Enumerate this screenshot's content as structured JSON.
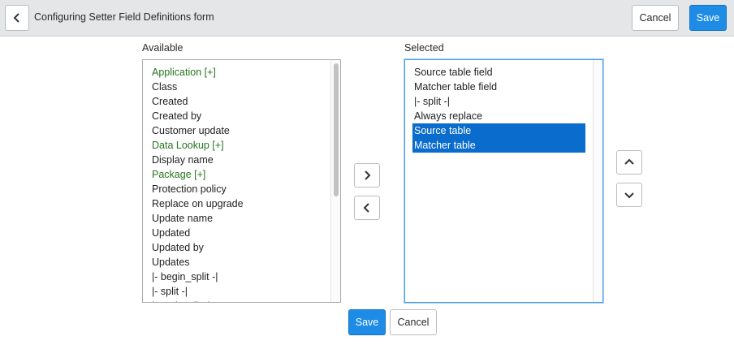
{
  "header": {
    "title": "Configuring Setter Field Definitions form",
    "cancel_label": "Cancel",
    "save_label": "Save",
    "back_icon": "chevron-left-icon"
  },
  "available": {
    "label": "Available",
    "items": [
      {
        "label": "Application [+]",
        "expandable": true
      },
      {
        "label": "Class",
        "expandable": false
      },
      {
        "label": "Created",
        "expandable": false
      },
      {
        "label": "Created by",
        "expandable": false
      },
      {
        "label": "Customer update",
        "expandable": false
      },
      {
        "label": "Data Lookup [+]",
        "expandable": true
      },
      {
        "label": "Display name",
        "expandable": false
      },
      {
        "label": "Package [+]",
        "expandable": true
      },
      {
        "label": "Protection policy",
        "expandable": false
      },
      {
        "label": "Replace on upgrade",
        "expandable": false
      },
      {
        "label": "Update name",
        "expandable": false
      },
      {
        "label": "Updated",
        "expandable": false
      },
      {
        "label": "Updated by",
        "expandable": false
      },
      {
        "label": "Updates",
        "expandable": false
      },
      {
        "label": "|- begin_split -|",
        "expandable": false
      },
      {
        "label": "|- split -|",
        "expandable": false
      },
      {
        "label": "|- end_split -|",
        "expandable": false
      }
    ]
  },
  "selected": {
    "label": "Selected",
    "items": [
      {
        "label": "Source table field",
        "highlighted": false
      },
      {
        "label": "Matcher table field",
        "highlighted": false
      },
      {
        "label": "|- split -|",
        "highlighted": false
      },
      {
        "label": "Always replace",
        "highlighted": false
      },
      {
        "label": "Source table",
        "highlighted": true
      },
      {
        "label": "Matcher table",
        "highlighted": true
      }
    ]
  },
  "controls": {
    "add_icon": "chevron-right-icon",
    "remove_icon": "chevron-left-icon",
    "move_up_icon": "chevron-up-icon",
    "move_down_icon": "chevron-down-icon"
  },
  "footer": {
    "save_label": "Save",
    "cancel_label": "Cancel"
  },
  "colors": {
    "accent": "#1e8ce6",
    "selection": "#0a6ccc",
    "expandable_text": "#26741d",
    "header_bg": "#e4e6e7"
  }
}
